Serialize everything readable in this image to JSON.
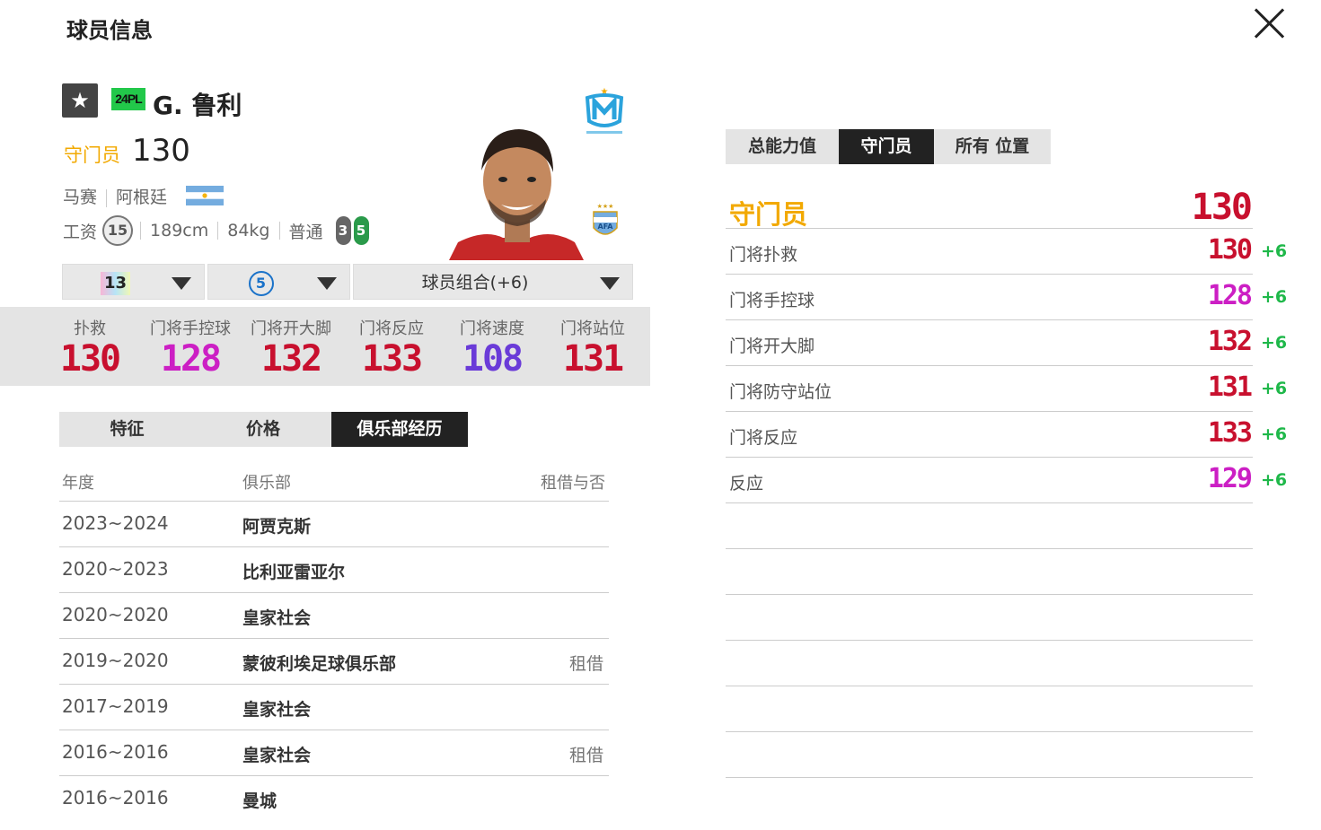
{
  "header": {
    "title": "球员信息"
  },
  "player": {
    "season_badge": "24PL",
    "name": "G. 鲁利",
    "position": "守门员",
    "position_ovr": "130",
    "club": "马赛",
    "nationality": "阿根廷",
    "wage_label": "工资",
    "wage": "15",
    "height": "189cm",
    "weight": "84kg",
    "body_type": "普通",
    "weak_foot": "3",
    "strong_foot": "5"
  },
  "dropdowns": {
    "upgrade_level": "13",
    "team_color_level": "5",
    "chemistry": "球员组合(+6)"
  },
  "stats": [
    {
      "label": "扑救",
      "value": "130",
      "color": "#c8102e"
    },
    {
      "label": "门将手控球",
      "value": "128",
      "color": "#cc1fc4"
    },
    {
      "label": "门将开大脚",
      "value": "132",
      "color": "#c8102e"
    },
    {
      "label": "门将反应",
      "value": "133",
      "color": "#c8102e"
    },
    {
      "label": "门将速度",
      "value": "108",
      "color": "#6a3bd8"
    },
    {
      "label": "门将站位",
      "value": "131",
      "color": "#c8102e"
    }
  ],
  "tabs": [
    "特征",
    "价格",
    "俱乐部经历"
  ],
  "history": {
    "headers": [
      "年度",
      "俱乐部",
      "租借与否"
    ],
    "rows": [
      {
        "year": "2023~2024",
        "club": "阿贾克斯",
        "loan": ""
      },
      {
        "year": "2020~2023",
        "club": "比利亚雷亚尔",
        "loan": ""
      },
      {
        "year": "2020~2020",
        "club": "皇家社会",
        "loan": ""
      },
      {
        "year": "2019~2020",
        "club": "蒙彼利埃足球俱乐部",
        "loan": "租借"
      },
      {
        "year": "2017~2019",
        "club": "皇家社会",
        "loan": ""
      },
      {
        "year": "2016~2016",
        "club": "皇家社会",
        "loan": "租借"
      },
      {
        "year": "2016~2016",
        "club": "曼城",
        "loan": ""
      }
    ]
  },
  "right_tabs": [
    "总能力值",
    "守门员",
    "所有 位置"
  ],
  "position_rating": {
    "label": "守门员",
    "value": "130"
  },
  "attributes": [
    {
      "label": "门将扑救",
      "value": "130",
      "bonus": "+6",
      "color": "#c8102e"
    },
    {
      "label": "门将手控球",
      "value": "128",
      "bonus": "+6",
      "color": "#cc1fc4"
    },
    {
      "label": "门将开大脚",
      "value": "132",
      "bonus": "+6",
      "color": "#c8102e"
    },
    {
      "label": "门将防守站位",
      "value": "131",
      "bonus": "+6",
      "color": "#c8102e"
    },
    {
      "label": "门将反应",
      "value": "133",
      "bonus": "+6",
      "color": "#c8102e"
    },
    {
      "label": "反应",
      "value": "129",
      "bonus": "+6",
      "color": "#cc1fc4"
    }
  ]
}
